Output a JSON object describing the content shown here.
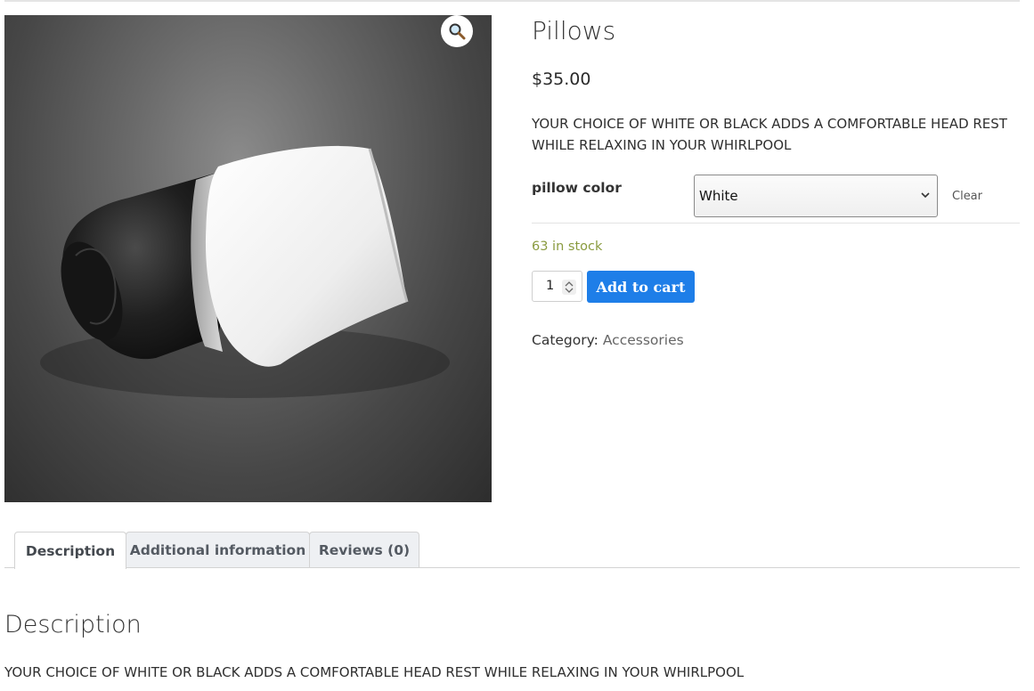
{
  "product": {
    "title": "Pillows",
    "price": "$35.00",
    "short_description": "YOUR CHOICE OF WHITE OR BLACK ADDS A COMFORTABLE HEAD REST WHILE RELAXING IN YOUR WHIRLPOOL",
    "image_alt": "pillow-photo",
    "zoom_icon": "magnifier-icon"
  },
  "variations": {
    "label": "pillow color",
    "selected": "White",
    "reset_label": "Clear"
  },
  "stock": "63 in stock",
  "cart": {
    "quantity": "1",
    "add_label": "Add to cart",
    "accent": "#1e7ee8"
  },
  "meta": {
    "category_label": "Category:",
    "category_value": "Accessories"
  },
  "tabs": [
    {
      "label": "Description",
      "active": true
    },
    {
      "label": "Additional information",
      "active": false
    },
    {
      "label": "Reviews (0)",
      "active": false
    }
  ],
  "description_panel": {
    "heading": "Description",
    "text": "YOUR CHOICE OF WHITE OR BLACK ADDS A COMFORTABLE HEAD REST WHILE RELAXING IN YOUR WHIRLPOOL"
  },
  "colors": {
    "stock_green": "#8a9b3f"
  }
}
